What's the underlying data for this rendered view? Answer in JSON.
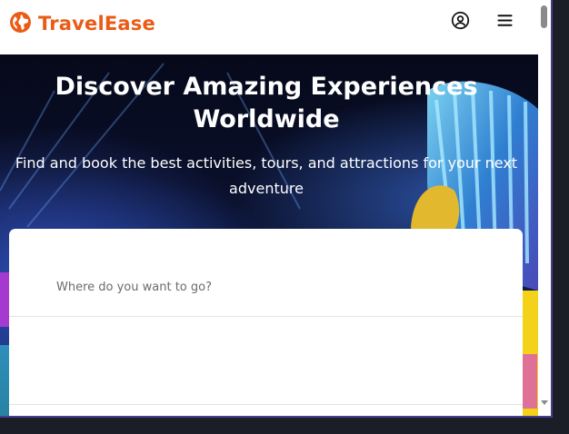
{
  "brand": {
    "name": "TravelEase",
    "color": "#ea5b16",
    "icon": "globe-icon"
  },
  "header": {
    "account_icon": "user-circle-icon",
    "menu_icon": "hamburger-menu-icon"
  },
  "hero": {
    "title": "Discover Amazing Experiences Worldwide",
    "subtitle": "Find and book the best activities, tours, and attractions for your next adventure"
  },
  "search": {
    "placeholder": "Where do you want to go?",
    "value": ""
  }
}
